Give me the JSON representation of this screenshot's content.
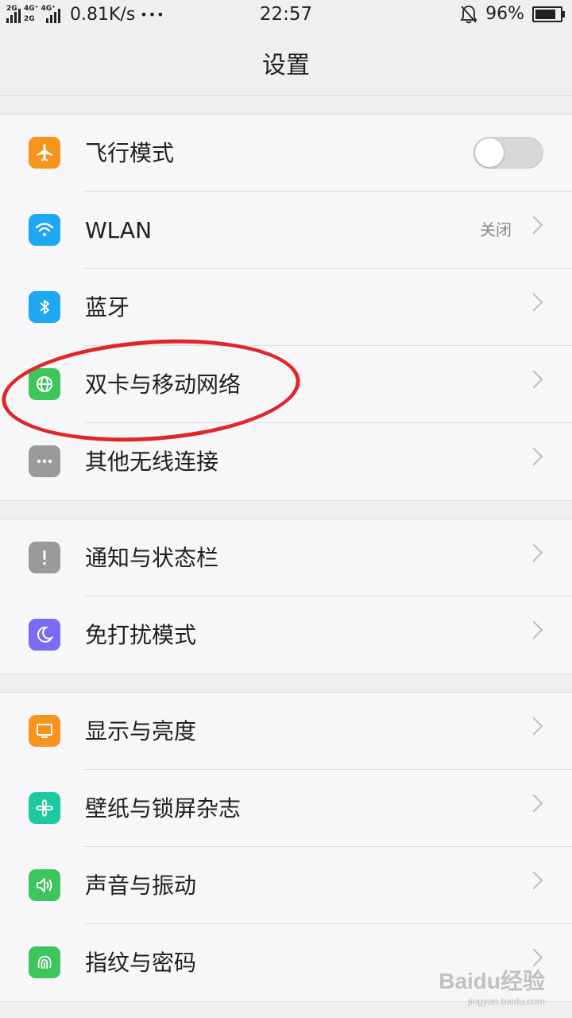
{
  "status_bar": {
    "sim1_tag": "2G",
    "sim2_tag": "4G⁺ 4G⁺",
    "sim3_tag": "2G",
    "network_speed": "0.81K/s",
    "more_dots": "•••",
    "time": "22:57",
    "battery_percent": "96%",
    "battery_level": 0.96
  },
  "header": {
    "title": "设置"
  },
  "groups": [
    {
      "items": [
        {
          "label": "飞行模式",
          "icon": "airplane-icon",
          "color": "#f7941d",
          "control": "toggle",
          "toggle_on": false
        },
        {
          "label": "WLAN",
          "icon": "wifi-icon",
          "color": "#1ea7f2",
          "value": "关闭"
        },
        {
          "label": "蓝牙",
          "icon": "bluetooth-icon",
          "color": "#1ea7f2"
        },
        {
          "label": "双卡与移动网络",
          "icon": "globe-icon",
          "color": "#3cc55a"
        },
        {
          "label": "其他无线连接",
          "icon": "more-icon",
          "color": "#9a999c"
        }
      ]
    },
    {
      "items": [
        {
          "label": "通知与状态栏",
          "icon": "exclamation-icon",
          "color": "#9a999c"
        },
        {
          "label": "免打扰模式",
          "icon": "moon-icon",
          "color": "#7a6cf2"
        }
      ]
    },
    {
      "items": [
        {
          "label": "显示与亮度",
          "icon": "monitor-icon",
          "color": "#f7941d"
        },
        {
          "label": "壁纸与锁屏杂志",
          "icon": "pinwheel-icon",
          "color": "#1dc9a0"
        },
        {
          "label": "声音与振动",
          "icon": "speaker-icon",
          "color": "#3cc55a"
        },
        {
          "label": "指纹与密码",
          "icon": "fingerprint-icon",
          "color": "#3cc55a"
        }
      ]
    }
  ],
  "watermark": {
    "main": "Baidu经验",
    "sub": "jingyan.baidu.com"
  }
}
